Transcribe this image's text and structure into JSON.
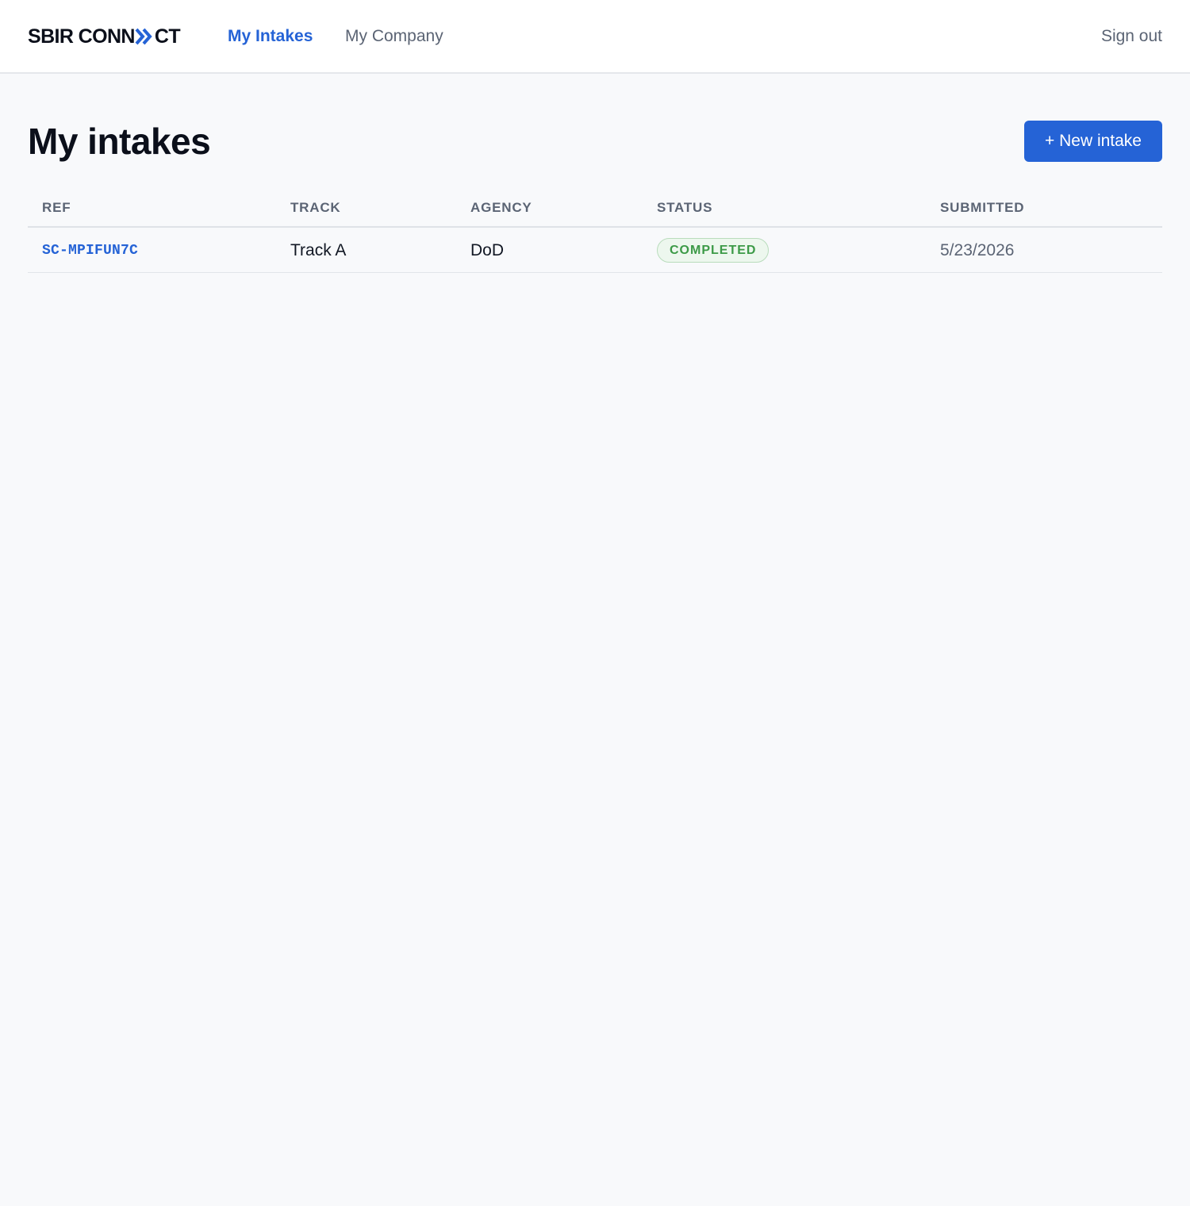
{
  "brand": {
    "logo_left": "SBIR CONN",
    "logo_right": "CT",
    "logo_icon": "double-chevron-right-icon",
    "accent_color": "#2563d6"
  },
  "nav": {
    "items": [
      {
        "label": "My Intakes",
        "active": true
      },
      {
        "label": "My Company",
        "active": false
      }
    ],
    "signout_label": "Sign out"
  },
  "page": {
    "title": "My intakes",
    "new_button_label": "+ New intake"
  },
  "table": {
    "columns": [
      "REF",
      "TRACK",
      "AGENCY",
      "STATUS",
      "SUBMITTED"
    ],
    "rows": [
      {
        "ref": "SC-MPIFUN7C",
        "track": "Track A",
        "agency": "DoD",
        "status": "COMPLETED",
        "submitted": "5/23/2026"
      }
    ]
  },
  "colors": {
    "status_completed_text": "#3c9a47",
    "status_completed_bg": "#edf7ee",
    "primary_button": "#2563d6"
  }
}
